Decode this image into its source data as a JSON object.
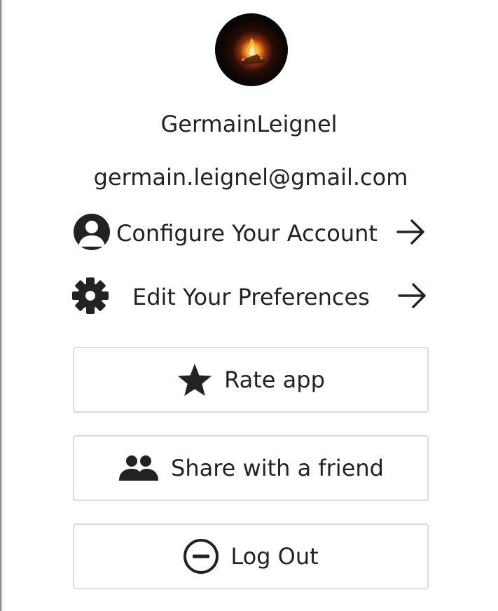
{
  "profile": {
    "avatar_alt": "campfire-avatar",
    "username": "GermainLeignel",
    "email": "germain.leignel@gmail.com"
  },
  "menu": {
    "configure_account": "Configure Your Account",
    "edit_preferences": "Edit Your Preferences"
  },
  "buttons": {
    "rate": "Rate app",
    "share": "Share with a friend",
    "logout": "Log Out"
  },
  "icons": {
    "account": "user-circle-icon",
    "preferences": "gear-icon",
    "arrow": "arrow-right-icon",
    "rate": "star-icon",
    "share": "users-icon",
    "logout": "minus-circle-icon"
  },
  "colors": {
    "text": "#222222",
    "border": "#dcdcdc",
    "background": "#ffffff"
  }
}
